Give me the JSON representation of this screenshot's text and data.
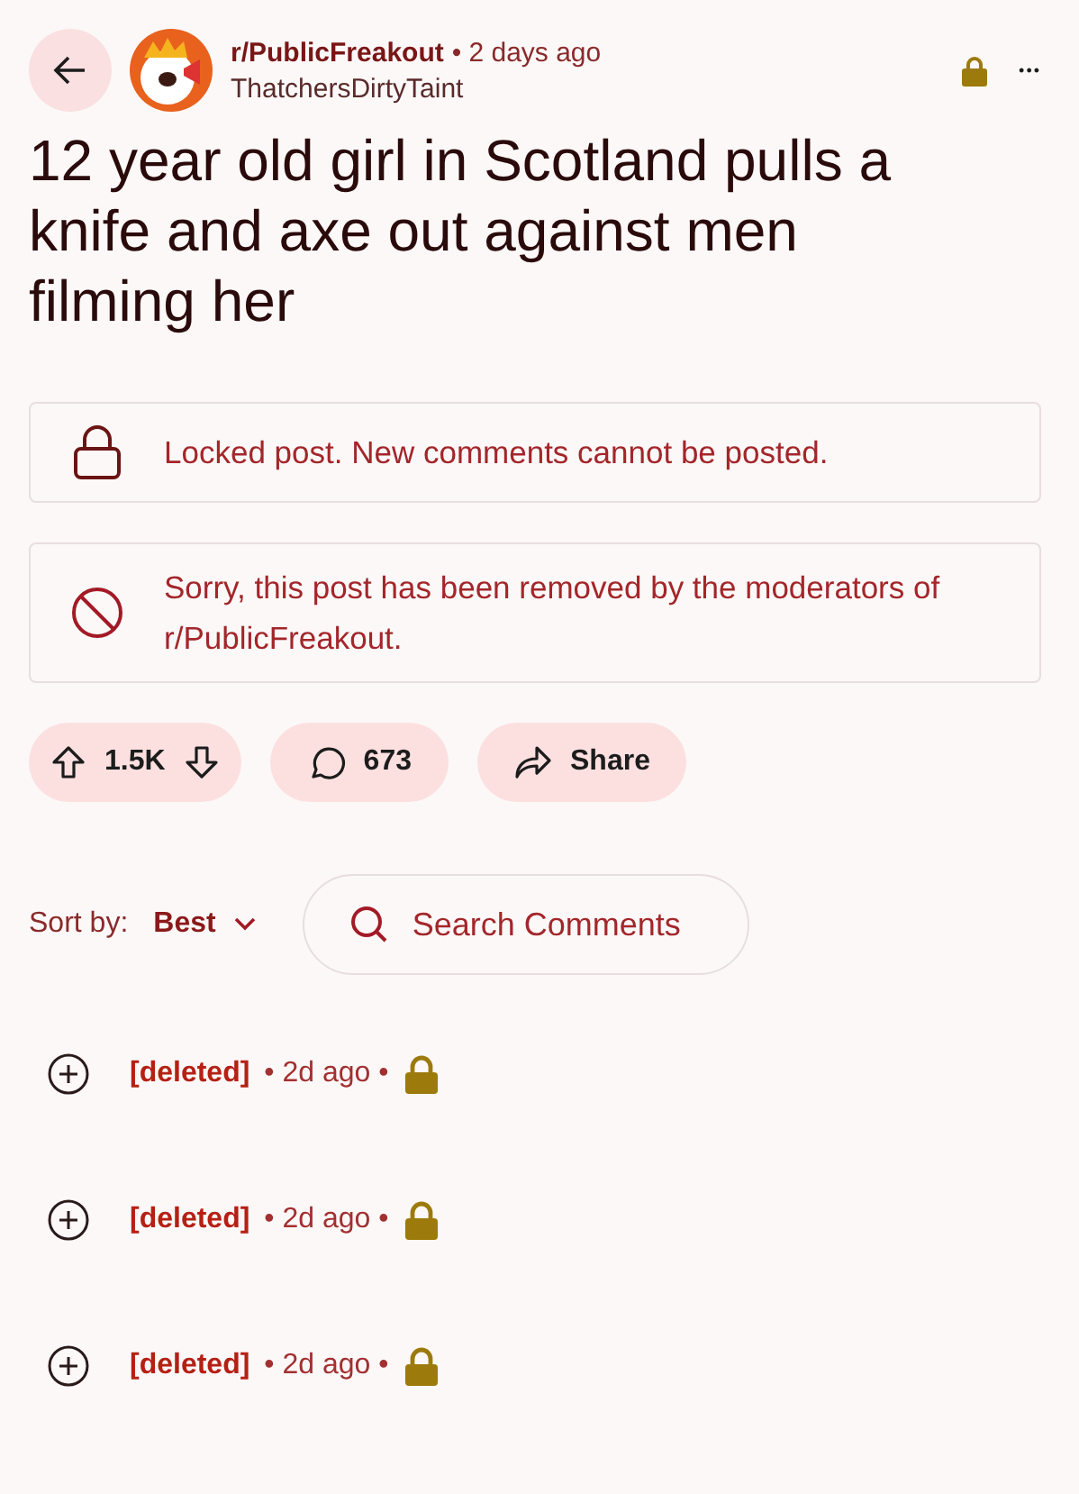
{
  "post": {
    "subreddit": "r/PublicFreakout",
    "time": "• 2 days ago",
    "author": "ThatchersDirtyTaint",
    "locked": true,
    "more": "•••",
    "title": "12 year old girl in Scotland pulls a knife and axe out against men filming her"
  },
  "notices": [
    {
      "kind": "locked",
      "text": "Locked post. New comments cannot be posted."
    },
    {
      "kind": "removed",
      "text": "Sorry, this post has been removed by the moderators of r/PublicFreakout."
    }
  ],
  "actions": {
    "votes": "1.5K",
    "comments": "673",
    "share": "Share"
  },
  "sort": {
    "label": "Sort by:",
    "value": "Best"
  },
  "search": {
    "placeholder": "Search Comments"
  },
  "comments": [
    {
      "author": "[deleted]",
      "time": "• 2d ago •",
      "locked": true
    },
    {
      "author": "[deleted]",
      "time": "• 2d ago •",
      "locked": true
    },
    {
      "author": "[deleted]",
      "time": "• 2d ago •",
      "locked": true
    }
  ]
}
